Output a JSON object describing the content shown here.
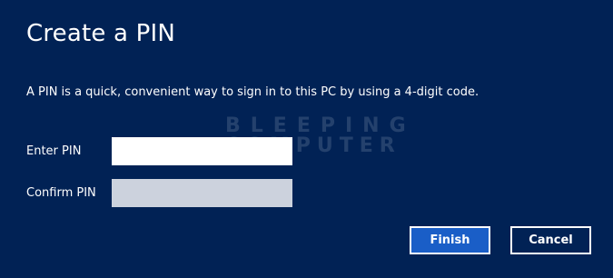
{
  "dialog": {
    "title": "Create a PIN",
    "description": "A PIN is a quick, convenient way to sign in to this PC by using a 4-digit code.",
    "watermark": {
      "line1": "BLEEPING",
      "line2": "COMPUTER"
    },
    "fields": {
      "enter_pin_label": "Enter PIN",
      "enter_pin_value": "",
      "confirm_pin_label": "Confirm PIN",
      "confirm_pin_value": ""
    },
    "buttons": {
      "finish_label": "Finish",
      "cancel_label": "Cancel"
    },
    "colors": {
      "background": "#012255",
      "primary_button": "#1a5ec7",
      "disabled_input": "#ccd2dd",
      "text": "#ffffff"
    }
  }
}
